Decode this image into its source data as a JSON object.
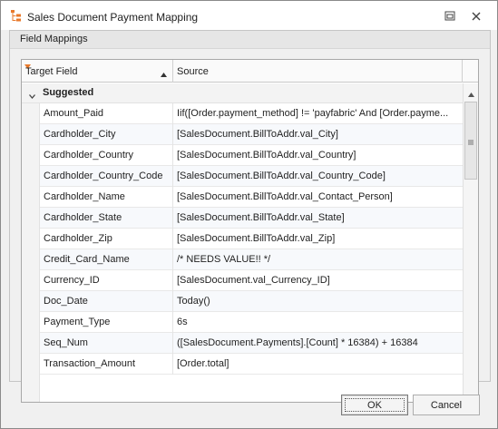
{
  "window": {
    "title": "Sales Document Payment Mapping",
    "app_icon": "hierarchy-icon",
    "controls": [
      "restore-icon",
      "close-icon"
    ]
  },
  "group": {
    "title": "Field Mappings"
  },
  "grid": {
    "columns": [
      {
        "label": "Target Field",
        "sort": "ascending",
        "filter_marker": true
      },
      {
        "label": "Source"
      }
    ],
    "groups": [
      {
        "label": "Suggested",
        "expanded": true,
        "rows": [
          {
            "target": "Amount_Paid",
            "source": "Iif([Order.payment_method] != 'payfabric' And [Order.payme..."
          },
          {
            "target": "Cardholder_City",
            "source": "[SalesDocument.BillToAddr.val_City]"
          },
          {
            "target": "Cardholder_Country",
            "source": "[SalesDocument.BillToAddr.val_Country]"
          },
          {
            "target": "Cardholder_Country_Code",
            "source": "[SalesDocument.BillToAddr.val_Country_Code]"
          },
          {
            "target": "Cardholder_Name",
            "source": "[SalesDocument.BillToAddr.val_Contact_Person]"
          },
          {
            "target": "Cardholder_State",
            "source": "[SalesDocument.BillToAddr.val_State]"
          },
          {
            "target": "Cardholder_Zip",
            "source": "[SalesDocument.BillToAddr.val_Zip]"
          },
          {
            "target": "Credit_Card_Name",
            "source": "/* NEEDS VALUE!! */"
          },
          {
            "target": "Currency_ID",
            "source": "[SalesDocument.val_Currency_ID]"
          },
          {
            "target": "Doc_Date",
            "source": "Today()"
          },
          {
            "target": "Payment_Type",
            "source": "6s"
          },
          {
            "target": "Seq_Num",
            "source": "([SalesDocument.Payments].[Count] * 16384) + 16384"
          },
          {
            "target": "Transaction_Amount",
            "source": "[Order.total]"
          }
        ]
      }
    ]
  },
  "buttons": {
    "ok_label": "OK",
    "cancel_label": "Cancel"
  },
  "colors": {
    "title_bar": "#ffffff",
    "dialog_bg": "#f0f0f0",
    "filter_marker": "#e8792b",
    "icon_orange": "#e8792b"
  }
}
